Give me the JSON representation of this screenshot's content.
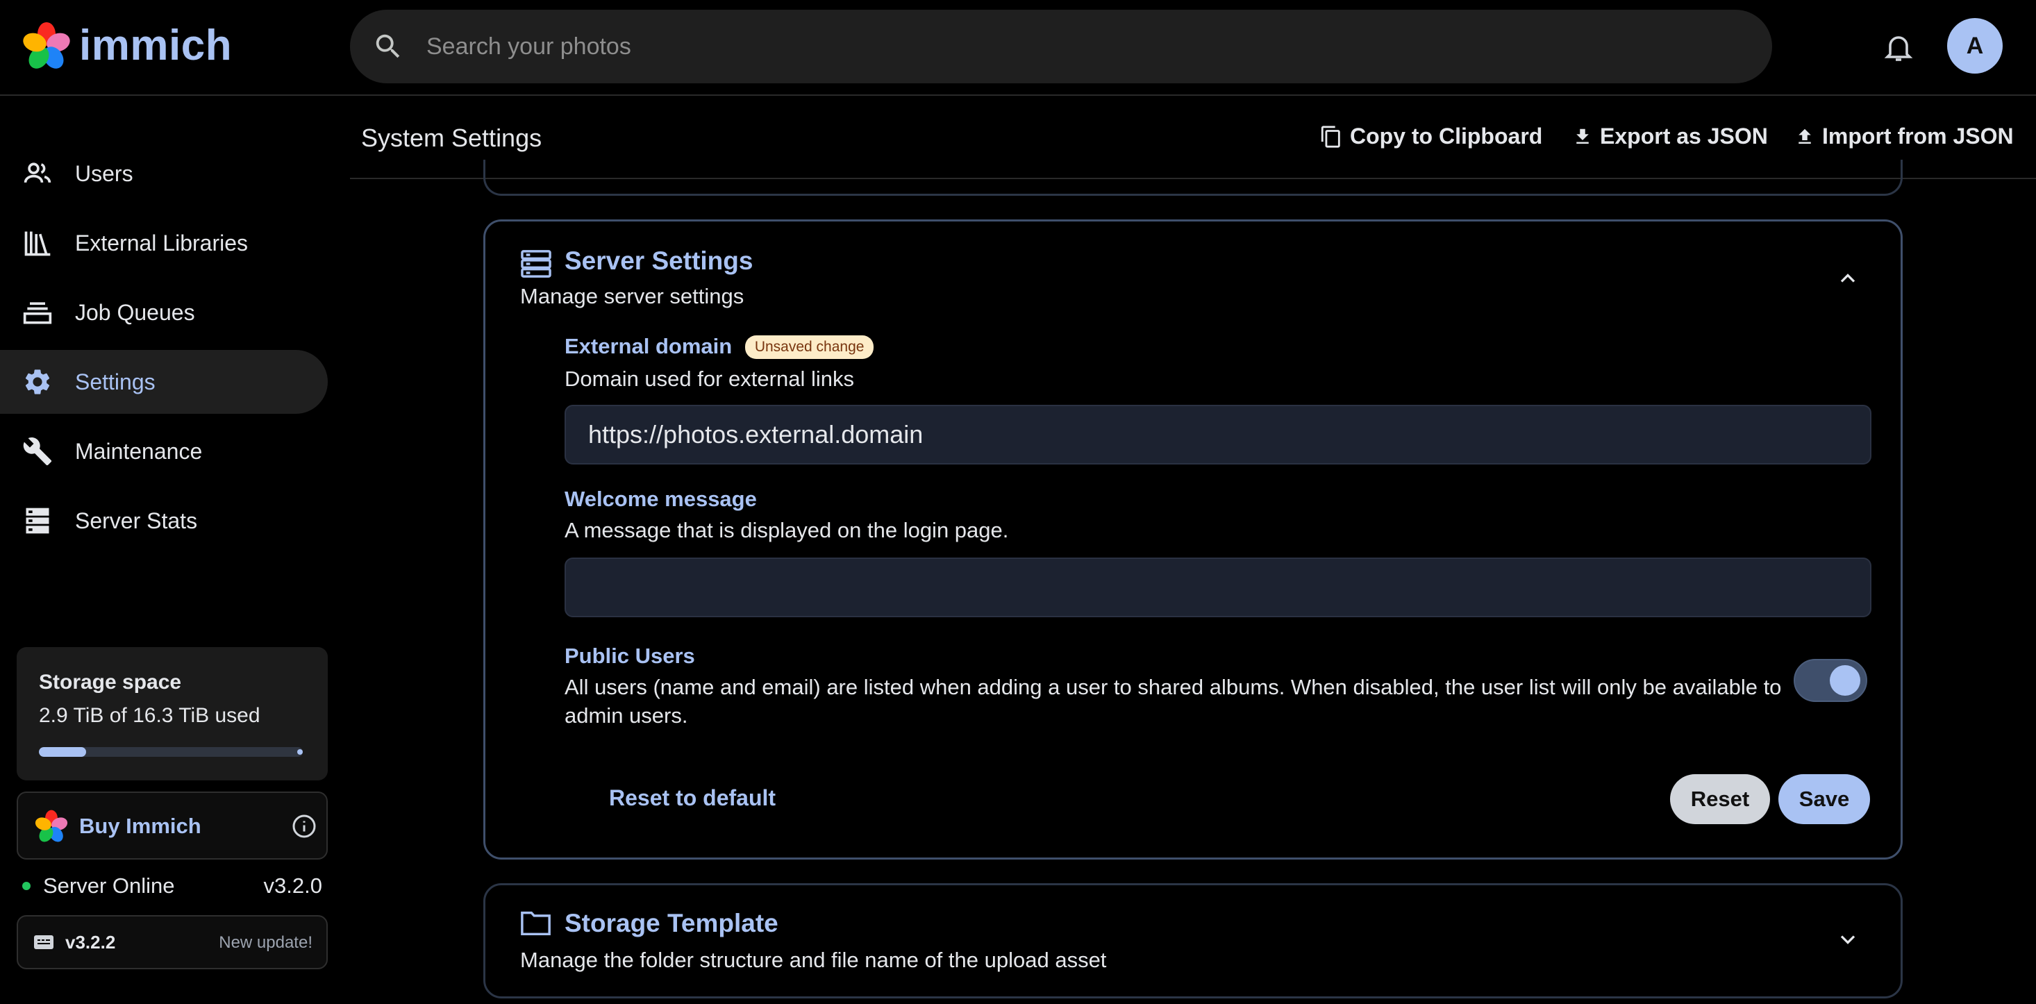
{
  "app": {
    "name": "immich"
  },
  "search": {
    "placeholder": "Search your photos"
  },
  "user": {
    "avatar_initial": "A"
  },
  "sidebar": {
    "items": [
      {
        "label": "Users",
        "icon": "users-icon",
        "active": false
      },
      {
        "label": "External Libraries",
        "icon": "library-icon",
        "active": false
      },
      {
        "label": "Job Queues",
        "icon": "queue-icon",
        "active": false
      },
      {
        "label": "Settings",
        "icon": "gear-icon",
        "active": true
      },
      {
        "label": "Maintenance",
        "icon": "wrench-icon",
        "active": false
      },
      {
        "label": "Server Stats",
        "icon": "server-icon",
        "active": false
      }
    ],
    "storage": {
      "title": "Storage space",
      "used_text": "2.9 TiB of 16.3 TiB used",
      "used_fraction": 0.178
    },
    "buy": {
      "label": "Buy Immich"
    },
    "server": {
      "status": "Server Online",
      "version": "v3.2.0"
    },
    "update": {
      "version": "v3.2.2",
      "label": "New update!"
    }
  },
  "header": {
    "title": "System Settings",
    "actions": [
      {
        "label": "Copy to Clipboard",
        "icon": "copy-icon"
      },
      {
        "label": "Export as JSON",
        "icon": "download-icon"
      },
      {
        "label": "Import from JSON",
        "icon": "upload-icon"
      }
    ]
  },
  "server_settings": {
    "title": "Server Settings",
    "subtitle": "Manage server settings",
    "external_domain": {
      "label": "External domain",
      "badge": "Unsaved change",
      "description": "Domain used for external links",
      "value": "https://photos.external.domain"
    },
    "welcome_message": {
      "label": "Welcome message",
      "description": "A message that is displayed on the login page.",
      "value": ""
    },
    "public_users": {
      "label": "Public Users",
      "description": "All users (name and email) are listed when adding a user to shared albums. When disabled, the user list will only be available to admin users.",
      "enabled": true
    },
    "reset_default_label": "Reset to default",
    "reset_label": "Reset",
    "save_label": "Save"
  },
  "storage_template": {
    "title": "Storage Template",
    "subtitle": "Manage the folder structure and file name of the upload asset"
  },
  "colors": {
    "accent": "#a9c2f3",
    "background": "#000000",
    "badge": "#fdecc8",
    "online": "#22c55e"
  }
}
